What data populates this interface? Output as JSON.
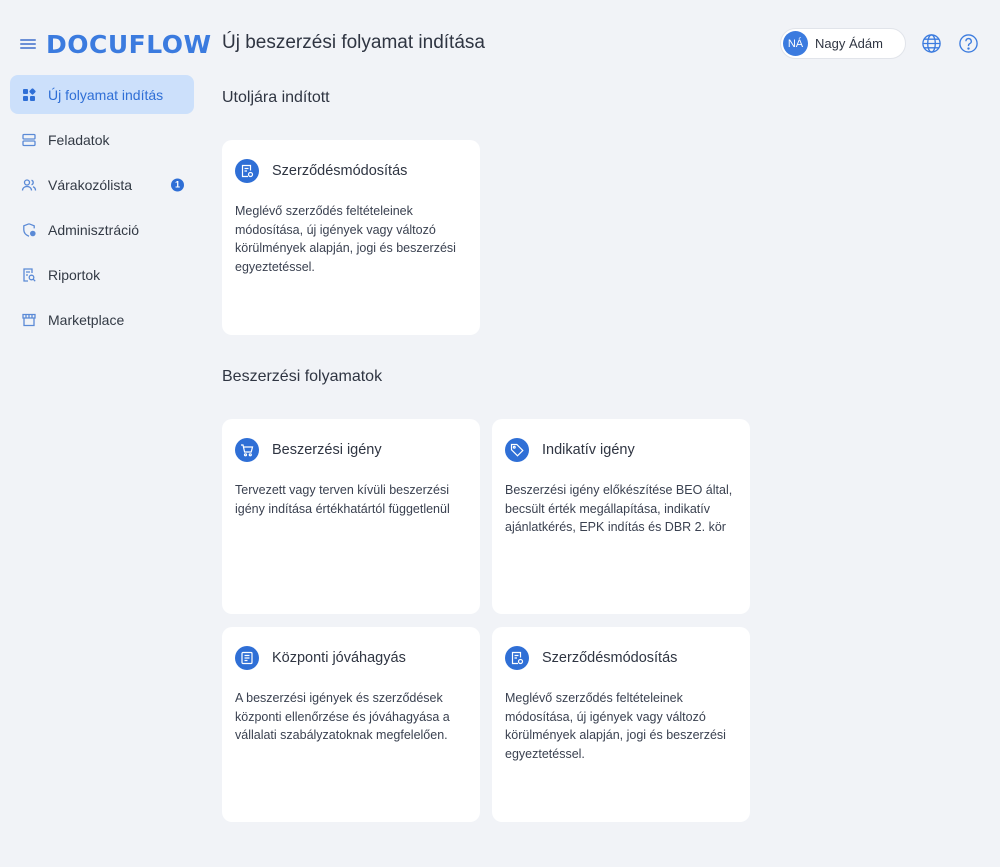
{
  "brand": {
    "logo_text": "DOCUFLOW",
    "accent": "#3b7bdf"
  },
  "sidebar": {
    "items": [
      {
        "label": "Új folyamat indítás",
        "icon": "grid-icon",
        "active": true
      },
      {
        "label": "Feladatok",
        "icon": "server-icon"
      },
      {
        "label": "Várakozólista",
        "icon": "users-icon",
        "badge": "1"
      },
      {
        "label": "Adminisztráció",
        "icon": "shield-lock-icon"
      },
      {
        "label": "Riportok",
        "icon": "report-search-icon"
      },
      {
        "label": "Marketplace",
        "icon": "store-icon"
      }
    ]
  },
  "header": {
    "title": "Új beszerzési folyamat indítása",
    "user": {
      "initials": "NÁ",
      "name": "Nagy Ádám"
    },
    "globe_icon": "globe-icon",
    "help_icon": "help-icon"
  },
  "recent": {
    "title": "Utoljára indított",
    "cards": [
      {
        "title": "Szerződésmódosítás",
        "icon": "contract-edit-icon",
        "description": "Meglévő szerződés feltételeinek módosítása, új igények vagy változó körülmények alapján, jogi és beszerzési egyeztetéssel."
      }
    ]
  },
  "processes": {
    "title": "Beszerzési folyamatok",
    "cards": [
      {
        "title": "Beszerzési igény",
        "icon": "cart-icon",
        "description": "Tervezett vagy terven kívüli beszerzési igény indítása értékhatártól függetlenül"
      },
      {
        "title": "Indikatív igény",
        "icon": "tag-icon",
        "description": "Beszerzési igény előkészítése BEO által, becsült érték megállapítása, indikatív ajánlatkérés, EPK indítás és DBR 2. kör"
      },
      {
        "title": "Központi jóváhagyás",
        "icon": "approval-doc-icon",
        "description": "A beszerzési igények és szerződések központi ellenőrzése és jóváhagyása a vállalati szabályzatoknak megfelelően."
      },
      {
        "title": "Szerződésmódosítás",
        "icon": "contract-edit-icon",
        "description": "Meglévő szerződés feltételeinek módosítása, új igények vagy változó körülmények alapján, jogi és beszerzési egyeztetéssel."
      }
    ]
  }
}
